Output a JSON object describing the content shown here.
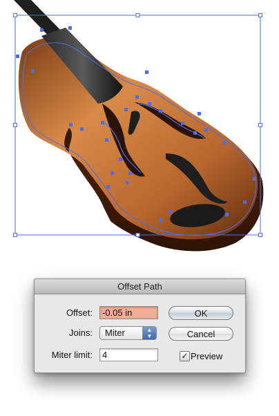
{
  "dialog": {
    "title": "Offset Path",
    "offset": {
      "label": "Offset:",
      "value": "-0.05 in"
    },
    "joins": {
      "label": "Joins:",
      "selected": "Miter"
    },
    "miter_limit": {
      "label": "Miter limit:",
      "value": "4"
    },
    "ok_label": "OK",
    "cancel_label": "Cancel",
    "preview": {
      "label": "Preview",
      "checked": true
    }
  },
  "colors": {
    "selection": "#4a6fe8",
    "violin_body": "#c46f34",
    "offset_highlight": "#f3ab93"
  },
  "artwork": {
    "subject": "violin-illustration",
    "icons": [
      "bounding-box-handle",
      "anchor-point",
      "checkmark-icon",
      "up-down-arrows-icon"
    ]
  }
}
